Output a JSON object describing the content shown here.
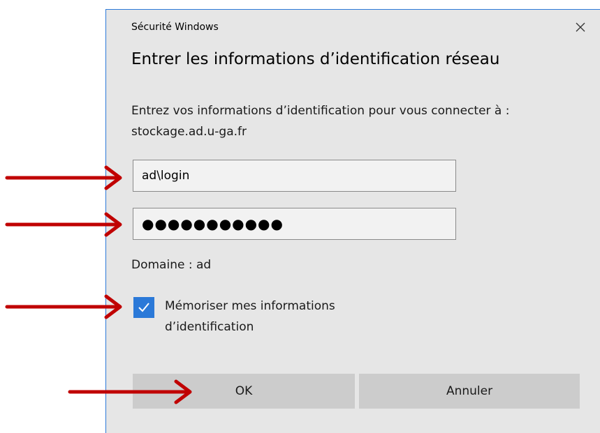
{
  "dialog": {
    "window_title": "Sécurité Windows",
    "heading": "Entrer les informations d’identification réseau",
    "description": "Entrez vos informations d’identification pour vous connecter à : stockage.ad.u-ga.fr",
    "username_value": "ad\\login",
    "password_mask": "●●●●●●●●●●●",
    "domain_text": "Domaine : ad",
    "remember_label": "Mémoriser mes informations d’identification",
    "remember_checked": true,
    "ok_label": "OK",
    "cancel_label": "Annuler"
  },
  "colors": {
    "accent": "#2b79d8",
    "annotation_arrow": "#c00000",
    "dialog_bg": "#e6e6e6",
    "button_bg": "#cccccc"
  },
  "icons": {
    "close": "close-icon",
    "check": "checkmark-icon",
    "arrow": "arrow-right-icon"
  }
}
